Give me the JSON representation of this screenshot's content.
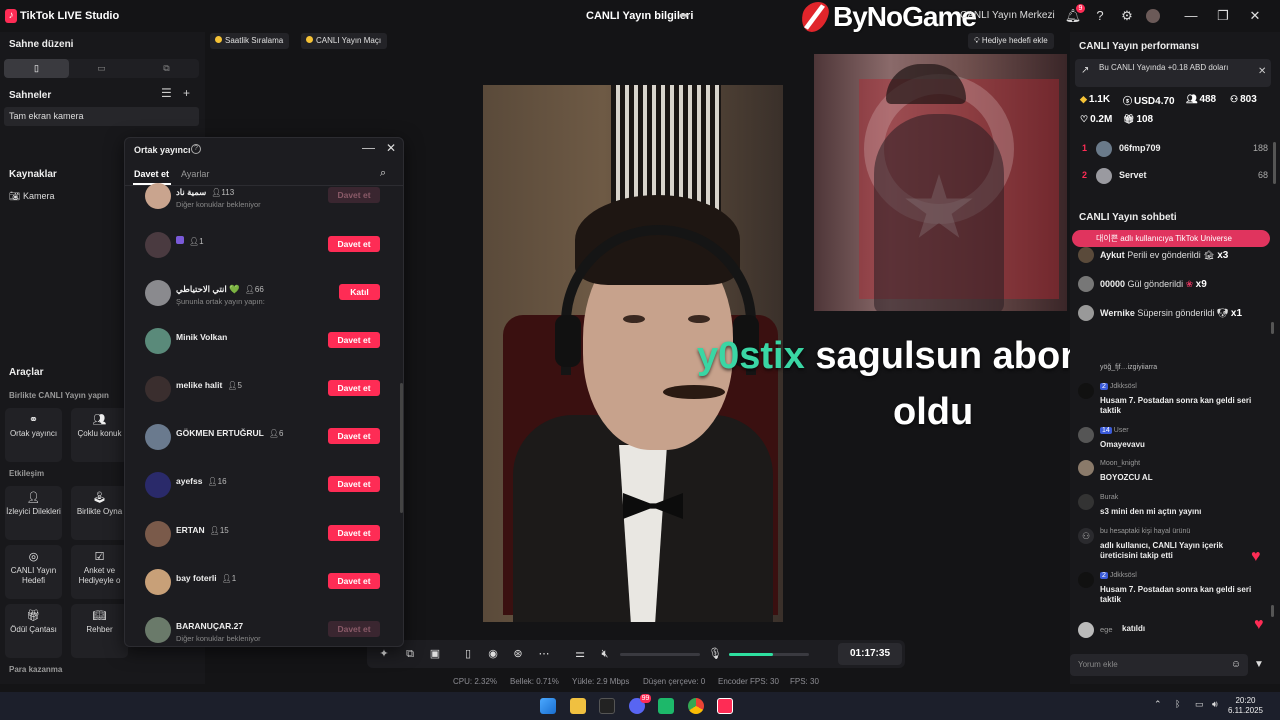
{
  "titlebar": {
    "app_name": "TikTok LIVE Studio",
    "center_title": "CANLI Yayın bilgileri",
    "brand_overlay": "ByNoGame",
    "live_center": "CANLI Yayın Merkezi",
    "notification_count": "9"
  },
  "left": {
    "stage_layout_title": "Sahne düzeni",
    "scenes_title": "Sahneler",
    "scene_item": "Tam ekran kamera",
    "sources_title": "Kaynaklar",
    "source_camera": "Kamera",
    "tools_title": "Araçlar",
    "together_live": "Birlikte CANLI Yayın yapın",
    "cohost": "Ortak yayıncı",
    "multi_guest": "Çoklu konuk",
    "interaction": "Etkileşim",
    "viewer_requests": "İzleyici Dilekleri",
    "play_together": "Birlikte Oyna",
    "live_goal": "CANLI Yayın Hedefi",
    "poll_gift": "Anket ve Hediyeyle o",
    "reward_bag": "Ödül Çantası",
    "guide": "Rehber",
    "earn_money": "Para kazanma"
  },
  "stage": {
    "tag_hourly": "Saatlik Sıralama",
    "tag_match": "CANLI Yayın Maçı",
    "gift_goal": "Hediye hedefi ekle",
    "overlay_highlight": "y0stix",
    "overlay_rest": "sagulsun abone",
    "overlay_line2": "oldu",
    "timer": "01:17:35",
    "volume_level": 0.55,
    "stats": {
      "cpu": "CPU: 2.32%",
      "memory": "Bellek: 0.71%",
      "upload": "Yükle: 2.9 Mbps",
      "dropped": "Düşen çerçeve: 0",
      "encoder_fps": "Encoder FPS: 30",
      "fps": "FPS: 30"
    }
  },
  "dialog": {
    "title": "Ortak yayıncı",
    "tab_invite": "Davet et",
    "tab_settings": "Ayarlar",
    "users": [
      {
        "name": "سمية ناد",
        "count": "113",
        "sub": "Diğer konuklar bekleniyor",
        "button": "Davet et",
        "dim": true
      },
      {
        "name": "",
        "count": "1",
        "sub": "",
        "button": "Davet et",
        "dim": false
      },
      {
        "name": "انتي الاحتياطي 💚",
        "count": "66",
        "sub": "Şununla ortak yayın yapın:",
        "button": "Katıl",
        "dim": false
      },
      {
        "name": "Minik Volkan",
        "count": "",
        "sub": "",
        "button": "Davet et",
        "dim": false
      },
      {
        "name": "melike halit",
        "count": "5",
        "sub": "",
        "button": "Davet et",
        "dim": false
      },
      {
        "name": "GÖKMEN ERTUĞRUL",
        "count": "6",
        "sub": "",
        "button": "Davet et",
        "dim": false
      },
      {
        "name": "ayefss",
        "count": "16",
        "sub": "",
        "button": "Davet et",
        "dim": false
      },
      {
        "name": "ERTAN",
        "count": "15",
        "sub": "",
        "button": "Davet et",
        "dim": false
      },
      {
        "name": "bay foterli",
        "count": "1",
        "sub": "",
        "button": "Davet et",
        "dim": false
      },
      {
        "name": "BARANUÇAR.27",
        "count": "",
        "sub": "Diğer konuklar bekleniyor",
        "button": "Davet et",
        "dim": true
      }
    ]
  },
  "right": {
    "perf_title": "CANLI Yayın performansı",
    "perf_card": "Bu CANLI Yayında +0.18 ABD doları",
    "metrics": {
      "diamonds": "1.1K",
      "usd": "USD4.70",
      "viewers": "488",
      "followers": "803",
      "likes": "0.2M",
      "gifts": "108"
    },
    "ranking": [
      {
        "rank": "1",
        "name": "06fmp709",
        "score": "188"
      },
      {
        "rank": "2",
        "name": "Servet",
        "score": "68"
      }
    ],
    "chat_title": "CANLI Yayın sohbeti",
    "pink_banner": "대이쁜 adlı kullanıcıya TikTok Universe",
    "gifts": [
      {
        "name": "Aykut",
        "text": "Perili ev gönderildi",
        "count": "x3"
      },
      {
        "name": "00000",
        "text": "Gül gönderildi",
        "count": "x9"
      },
      {
        "name": "Wernike",
        "text": "Süpersin gönderildi",
        "count": "x1"
      }
    ],
    "partial_msg": "yöğ_fjf…izgiyiiarra",
    "messages": [
      {
        "level": "2",
        "user": "Jdkksösl",
        "text": "Husam 7. Postadan sonra kan geldi seri taktik"
      },
      {
        "level": "14",
        "user": "User",
        "text": "Omayevavu"
      },
      {
        "level": "",
        "user": "Moon_knight",
        "text": "BOYOZCU AL"
      },
      {
        "level": "",
        "user": "Burak",
        "text": "s3 mini den mi açtın yayını"
      },
      {
        "level": "",
        "user": "bu hesaptaki kişi hayal ürünü",
        "text": "adlı kullanıcı, CANLI Yayın içerik üreticisini takip etti"
      },
      {
        "level": "2",
        "user": "Jdkksösl",
        "text": "Husam 7. Postadan sonra kan geldi seri taktik"
      },
      {
        "level": "",
        "user": "ege",
        "text": "katıldı"
      }
    ],
    "comment_placeholder": "Yorum ekle"
  },
  "taskbar": {
    "time": "20:20",
    "date": "6.11.2025",
    "discord_badge": "99"
  }
}
